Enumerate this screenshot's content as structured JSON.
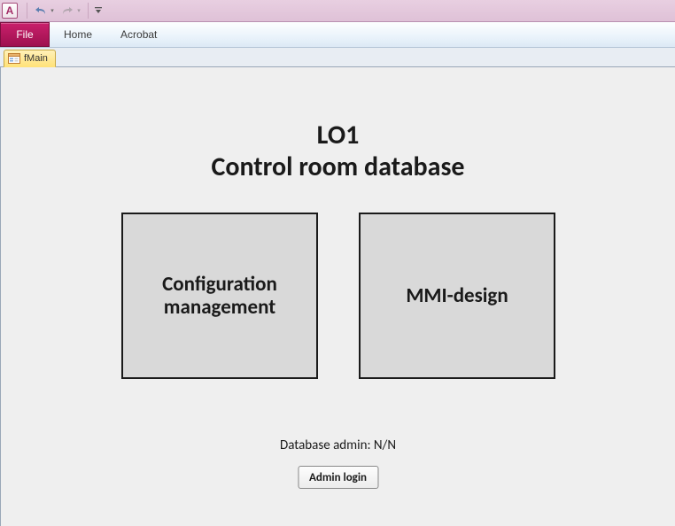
{
  "app_icon_letter": "A",
  "ribbon": {
    "file_label": "File",
    "tabs": [
      "Home",
      "Acrobat"
    ]
  },
  "doctab": {
    "label": "fMain"
  },
  "form": {
    "title_line1": "LO1",
    "title_line2": "Control room database",
    "big_buttons": {
      "config": "Configuration management",
      "mmi": "MMI-design"
    },
    "admin_status": "Database admin: N/N",
    "admin_login_label": "Admin login"
  }
}
